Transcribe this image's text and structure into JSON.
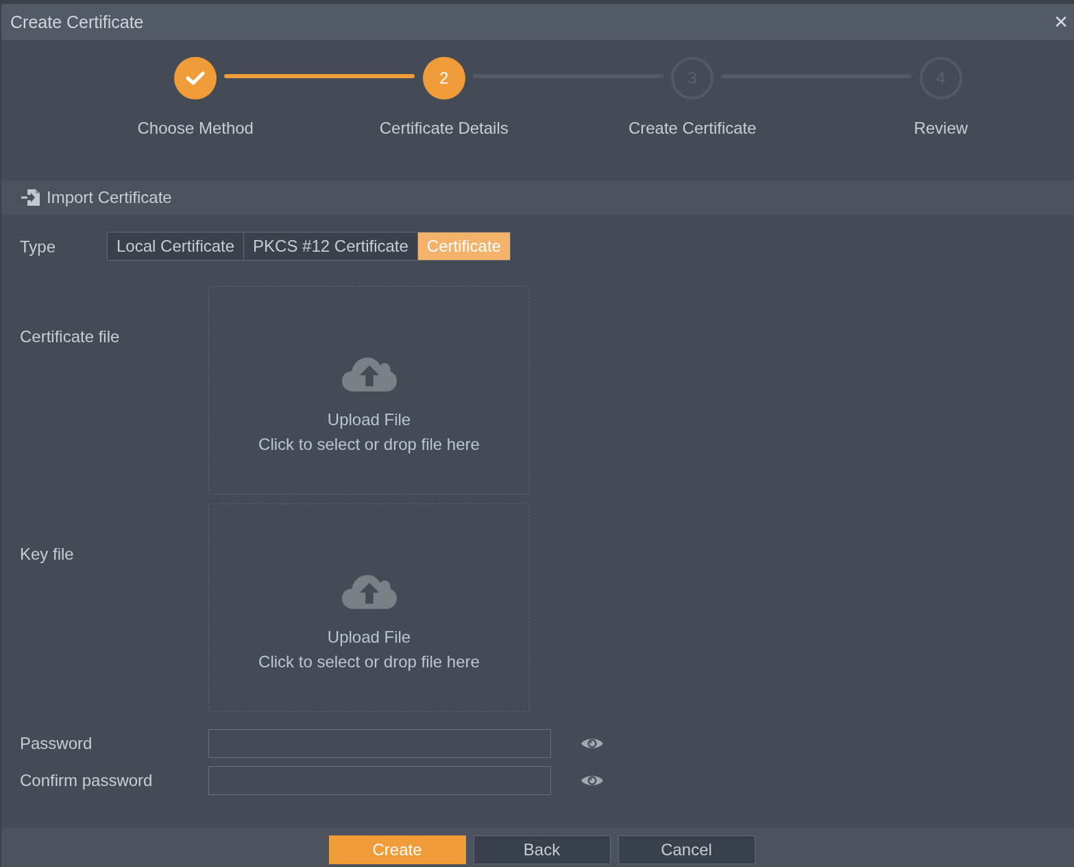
{
  "window": {
    "title": "Create Certificate",
    "close": "✕"
  },
  "steps": [
    {
      "label": "Choose Method",
      "completed": true,
      "selected": false
    },
    {
      "label": "Certificate Details",
      "number": "2",
      "completed": false,
      "selected": true
    },
    {
      "label": "Create Certificate",
      "number": "3",
      "completed": false,
      "selected": false
    },
    {
      "label": "Review",
      "number": "4",
      "completed": false,
      "selected": false
    }
  ],
  "section": {
    "title": "Import Certificate"
  },
  "form": {
    "type": {
      "label": "Type",
      "options": [
        {
          "label": "Local Certificate",
          "selected": false
        },
        {
          "label": "PKCS #12 Certificate",
          "selected": false
        },
        {
          "label": "Certificate",
          "selected": true
        }
      ]
    },
    "uploads": [
      {
        "label": "Certificate file",
        "title": "Upload File",
        "hint": "Click to select or drop file here"
      },
      {
        "label": "Key file",
        "title": "Upload File",
        "hint": "Click to select or drop file here"
      }
    ],
    "passwords": [
      {
        "label": "Password"
      },
      {
        "label": "Confirm password"
      }
    ]
  },
  "buttons": [
    {
      "label": "Create",
      "kind": "primary"
    },
    {
      "label": "Back",
      "kind": "secondary"
    },
    {
      "label": "Cancel",
      "kind": "secondary"
    }
  ]
}
